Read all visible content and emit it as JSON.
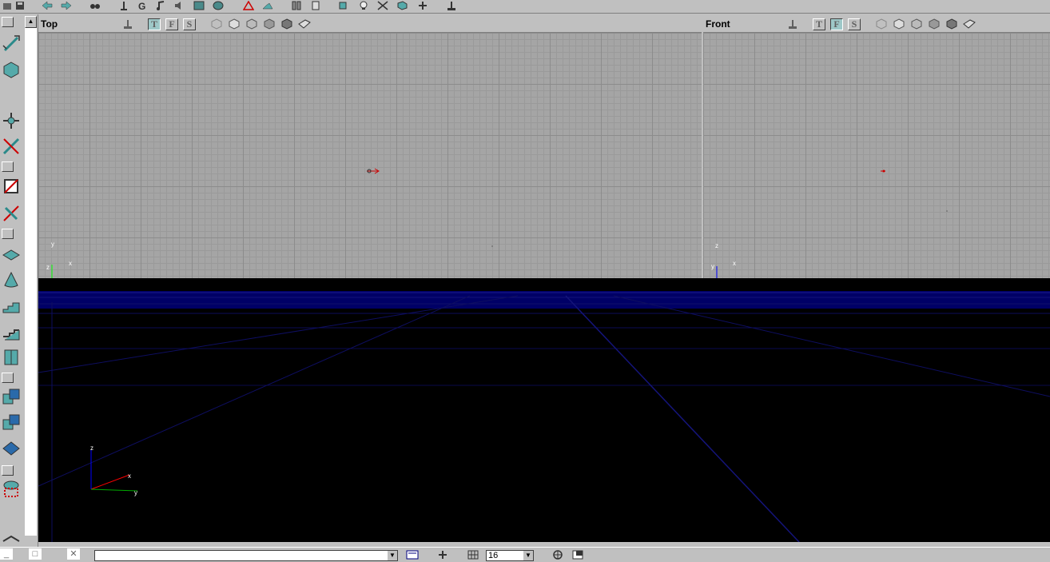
{
  "viewports": {
    "top": {
      "title": "Top",
      "axes": {
        "up": "y",
        "right": "x",
        "origin": "z"
      }
    },
    "front": {
      "title": "Front",
      "axes": {
        "up": "z",
        "right": "x",
        "origin": "y"
      }
    },
    "perspective": {
      "axes": {
        "up": "z",
        "x": "x",
        "y": "y"
      }
    }
  },
  "view_modes": {
    "t": "T",
    "f": "F",
    "s": "S"
  },
  "statusbar": {
    "grid_size": "16",
    "window_minimize": "_",
    "window_restore": "□",
    "window_close": "✕"
  },
  "colors": {
    "accent": "#9ec8c8",
    "viewport_bg": "#a5a5a5",
    "perspective_bg": "#000000",
    "grid_line_3d": "#101060"
  }
}
